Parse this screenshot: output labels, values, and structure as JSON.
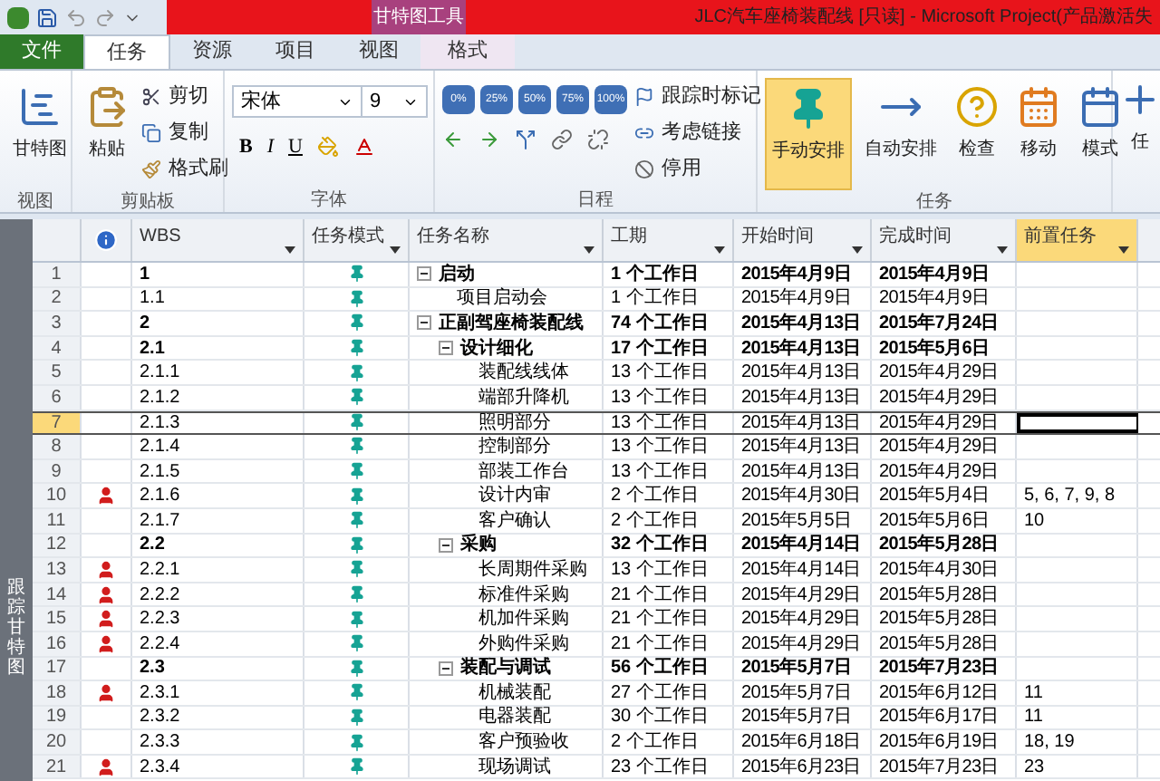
{
  "title_bar": {
    "context_label": "甘特图工具",
    "title": "JLC汽车座椅装配线 [只读]  -  Microsoft Project(产品激活失"
  },
  "tabs": [
    {
      "label": "文件",
      "kind": "file",
      "selected": false
    },
    {
      "label": "任务",
      "kind": "normal",
      "selected": true
    },
    {
      "label": "资源",
      "kind": "normal",
      "selected": false
    },
    {
      "label": "项目",
      "kind": "normal",
      "selected": false
    },
    {
      "label": "视图",
      "kind": "normal",
      "selected": false
    },
    {
      "label": "格式",
      "kind": "context",
      "selected": false
    }
  ],
  "ribbon": {
    "view": {
      "label": "视图",
      "button": "甘特图"
    },
    "clipboard": {
      "label": "剪贴板",
      "paste": "粘贴",
      "cut": "剪切",
      "copy": "复制",
      "format_painter": "格式刷"
    },
    "font": {
      "label": "字体",
      "font_name": "宋体",
      "font_size": "9",
      "bold": "B",
      "italic": "I",
      "underline": "U"
    },
    "schedule": {
      "label": "日程",
      "progress_buttons": [
        "0%",
        "25%",
        "50%",
        "75%",
        "100%"
      ],
      "mark_on_track": "跟踪时标记",
      "respect_links": "考虑链接",
      "inactivate": "停用"
    },
    "tasks": {
      "label": "任务",
      "buttons": [
        {
          "label": "手动安排",
          "selected": true
        },
        {
          "label": "自动安排",
          "selected": false
        },
        {
          "label": "检查",
          "selected": false
        },
        {
          "label": "移动",
          "selected": false
        },
        {
          "label": "模式",
          "selected": false
        }
      ]
    },
    "insert": {
      "button": "任"
    }
  },
  "view_bar": {
    "label": "跟踪甘特图"
  },
  "columns": [
    {
      "label": "WBS",
      "selected": false
    },
    {
      "label": "任务模式",
      "selected": false
    },
    {
      "label": "任务名称",
      "selected": false
    },
    {
      "label": "工期",
      "selected": false
    },
    {
      "label": "开始时间",
      "selected": false
    },
    {
      "label": "完成时间",
      "selected": false
    },
    {
      "label": "前置任务",
      "selected": true
    }
  ],
  "tasks": [
    {
      "id": "1",
      "wbs": "1",
      "name": "启动",
      "duration": "1 个工作日",
      "start": "2015年4月9日",
      "finish": "2015年4月9日",
      "resource": false,
      "selected": false,
      "expanded": true,
      "children": [
        {
          "id": "2",
          "wbs": "1.1",
          "name": "项目启动会",
          "duration": "1 个工作日",
          "start": "2015年4月9日",
          "finish": "2015年4月9日",
          "resource": false,
          "selected": false
        }
      ]
    },
    {
      "id": "3",
      "wbs": "2",
      "name": "正副驾座椅装配线",
      "duration": "74 个工作日",
      "start": "2015年4月13日",
      "finish": "2015年7月24日",
      "resource": false,
      "selected": false,
      "expanded": true,
      "children": [
        {
          "id": "4",
          "wbs": "2.1",
          "name": "设计细化",
          "duration": "17 个工作日",
          "start": "2015年4月13日",
          "finish": "2015年5月6日",
          "resource": false,
          "selected": false,
          "expanded": true,
          "children": [
            {
              "id": "5",
              "wbs": "2.1.1",
              "name": "装配线线体",
              "duration": "13 个工作日",
              "start": "2015年4月13日",
              "finish": "2015年4月29日",
              "resource": false,
              "selected": false
            },
            {
              "id": "6",
              "wbs": "2.1.2",
              "name": "端部升降机",
              "duration": "13 个工作日",
              "start": "2015年4月13日",
              "finish": "2015年4月29日",
              "resource": false,
              "selected": false
            },
            {
              "id": "7",
              "wbs": "2.1.3",
              "name": "照明部分",
              "duration": "13 个工作日",
              "start": "2015年4月13日",
              "finish": "2015年4月29日",
              "resource": false,
              "selected": true
            },
            {
              "id": "8",
              "wbs": "2.1.4",
              "name": "控制部分",
              "duration": "13 个工作日",
              "start": "2015年4月13日",
              "finish": "2015年4月29日",
              "resource": false,
              "selected": false
            },
            {
              "id": "9",
              "wbs": "2.1.5",
              "name": "部装工作台",
              "duration": "13 个工作日",
              "start": "2015年4月13日",
              "finish": "2015年4月29日",
              "resource": false,
              "selected": false
            },
            {
              "id": "10",
              "wbs": "2.1.6",
              "name": "设计内审",
              "duration": "2 个工作日",
              "start": "2015年4月30日",
              "finish": "2015年5月4日",
              "predecessors": "5, 6, 7, 9, 8",
              "resource": true,
              "selected": false
            },
            {
              "id": "11",
              "wbs": "2.1.7",
              "name": "客户确认",
              "duration": "2 个工作日",
              "start": "2015年5月5日",
              "finish": "2015年5月6日",
              "predecessors": "10",
              "resource": false,
              "selected": false
            }
          ]
        },
        {
          "id": "12",
          "wbs": "2.2",
          "name": "采购",
          "duration": "32 个工作日",
          "start": "2015年4月14日",
          "finish": "2015年5月28日",
          "resource": false,
          "selected": false,
          "expanded": true,
          "children": [
            {
              "id": "13",
              "wbs": "2.2.1",
              "name": "长周期件采购",
              "duration": "13 个工作日",
              "start": "2015年4月14日",
              "finish": "2015年4月30日",
              "resource": true,
              "selected": false
            },
            {
              "id": "14",
              "wbs": "2.2.2",
              "name": "标准件采购",
              "duration": "21 个工作日",
              "start": "2015年4月29日",
              "finish": "2015年5月28日",
              "resource": true,
              "selected": false
            },
            {
              "id": "15",
              "wbs": "2.2.3",
              "name": "机加件采购",
              "duration": "21 个工作日",
              "start": "2015年4月29日",
              "finish": "2015年5月28日",
              "resource": true,
              "selected": false
            },
            {
              "id": "16",
              "wbs": "2.2.4",
              "name": "外购件采购",
              "duration": "21 个工作日",
              "start": "2015年4月29日",
              "finish": "2015年5月28日",
              "resource": true,
              "selected": false
            }
          ]
        },
        {
          "id": "17",
          "wbs": "2.3",
          "name": "装配与调试",
          "duration": "56 个工作日",
          "start": "2015年5月7日",
          "finish": "2015年7月23日",
          "resource": false,
          "selected": false,
          "expanded": true,
          "children": [
            {
              "id": "18",
              "wbs": "2.3.1",
              "name": "机械装配",
              "duration": "27 个工作日",
              "start": "2015年5月7日",
              "finish": "2015年6月12日",
              "predecessors": "11",
              "resource": true,
              "selected": false
            },
            {
              "id": "19",
              "wbs": "2.3.2",
              "name": "电器装配",
              "duration": "30 个工作日",
              "start": "2015年5月7日",
              "finish": "2015年6月17日",
              "predecessors": "11",
              "resource": false,
              "selected": false
            },
            {
              "id": "20",
              "wbs": "2.3.3",
              "name": "客户预验收",
              "duration": "2 个工作日",
              "start": "2015年6月18日",
              "finish": "2015年6月19日",
              "predecessors": "18, 19",
              "resource": false,
              "selected": false
            },
            {
              "id": "21",
              "wbs": "2.3.4",
              "name": "现场调试",
              "duration": "23 个工作日",
              "start": "2015年6月23日",
              "finish": "2015年7月23日",
              "predecessors": "23",
              "resource": true,
              "selected": false
            }
          ]
        }
      ]
    }
  ]
}
